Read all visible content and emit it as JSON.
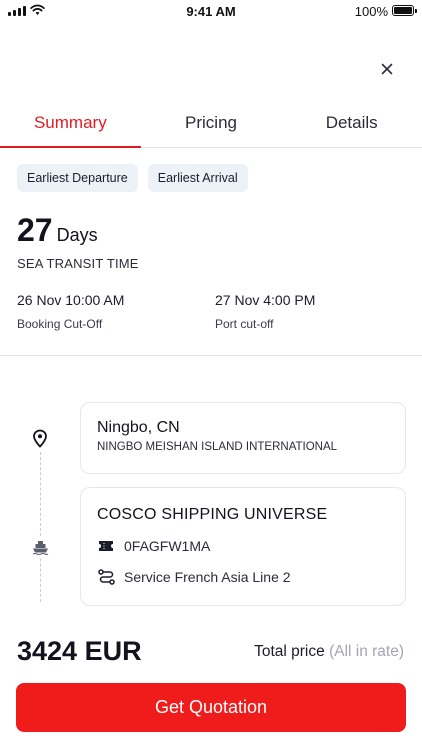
{
  "status_bar": {
    "time": "9:41 AM",
    "battery": "100%",
    "icons": [
      "signal-icon",
      "wifi-icon",
      "battery-icon"
    ]
  },
  "header": {
    "close_icon": "close-icon"
  },
  "tabs": [
    {
      "label": "Summary",
      "active": true
    },
    {
      "label": "Pricing",
      "active": false
    },
    {
      "label": "Details",
      "active": false
    }
  ],
  "filters": [
    {
      "label": "Earliest Departure"
    },
    {
      "label": "Earliest Arrival"
    }
  ],
  "transit": {
    "days": "27",
    "unit": "Days",
    "label": "SEA TRANSIT TIME"
  },
  "booking_cutoff": {
    "value": "26 Nov 10:00 AM",
    "label": "Booking Cut-Off"
  },
  "port_cutoff": {
    "value": "27 Nov 4:00 PM",
    "label": "Port cut-off"
  },
  "origin": {
    "name": "Ningbo, CN",
    "terminal": "NINGBO MEISHAN ISLAND INTERNATIONAL",
    "icon": "location-pin-icon"
  },
  "vessel": {
    "name": "COSCO SHIPPING UNIVERSE",
    "code": "0FAGFW1MA",
    "service": "Service French Asia Line 2",
    "icon": "ship-icon",
    "code_icon": "ticket-icon",
    "service_icon": "route-icon"
  },
  "price": {
    "amount": "3424 EUR",
    "label": "Total price",
    "note": "(All in rate)"
  },
  "cta": {
    "label": "Get Quotation"
  },
  "colors": {
    "accent": "#e21b23",
    "button": "#f01c1c",
    "chip_bg": "#edf2f8",
    "muted": "#a3a6b2"
  }
}
